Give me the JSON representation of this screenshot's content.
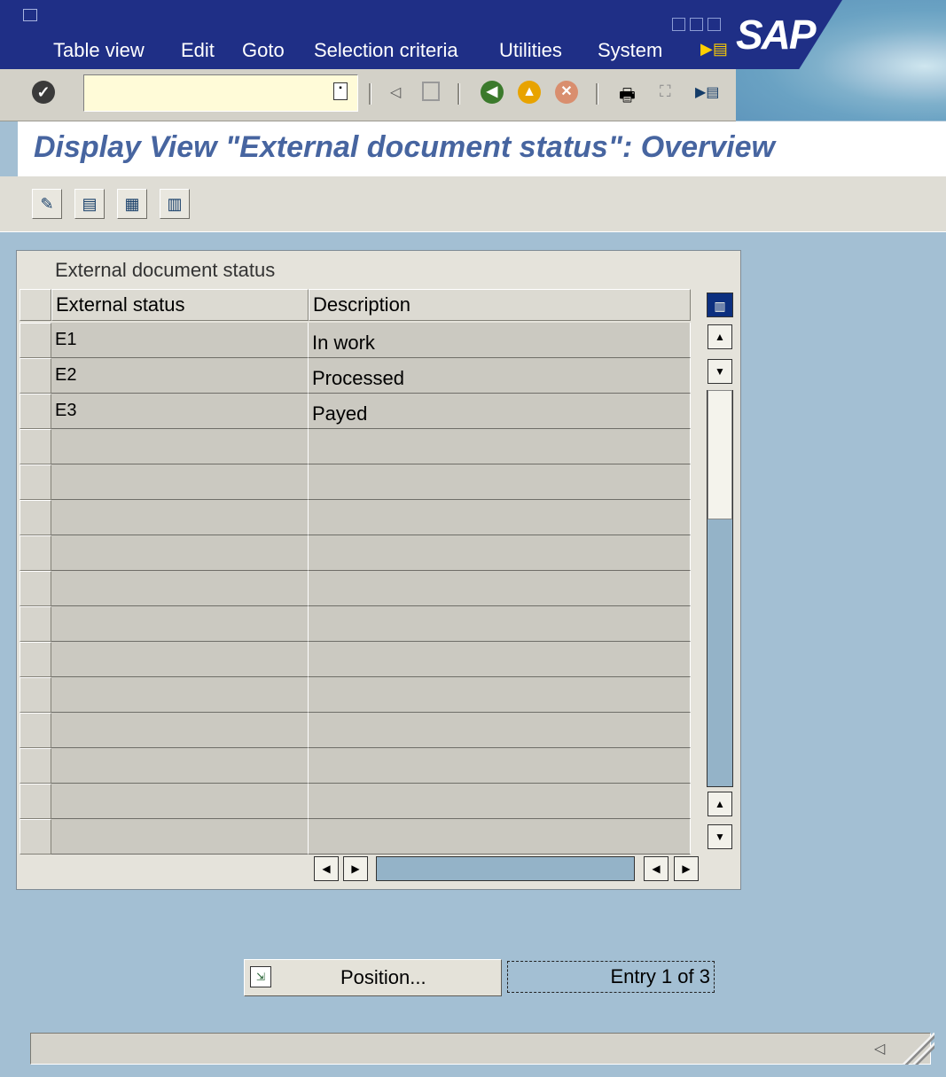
{
  "menubar": {
    "items": [
      "Table view",
      "Edit",
      "Goto",
      "Selection criteria",
      "Utilities",
      "System"
    ],
    "logo": "SAP"
  },
  "toolbar": {
    "command_value": ""
  },
  "title": "Display View \"External document status\": Overview",
  "table": {
    "title": "External document status",
    "columns": [
      "External status",
      "Description"
    ],
    "rows": [
      [
        "E1",
        "In work"
      ],
      [
        "E2",
        "Processed"
      ],
      [
        "E3",
        "Payed"
      ],
      [
        "",
        ""
      ],
      [
        "",
        ""
      ],
      [
        "",
        ""
      ],
      [
        "",
        ""
      ],
      [
        "",
        ""
      ],
      [
        "",
        ""
      ],
      [
        "",
        ""
      ],
      [
        "",
        ""
      ],
      [
        "",
        ""
      ],
      [
        "",
        ""
      ],
      [
        "",
        ""
      ],
      [
        "",
        ""
      ]
    ]
  },
  "bottom": {
    "position_label": "Position...",
    "entry_text": "Entry 1 of 3"
  }
}
